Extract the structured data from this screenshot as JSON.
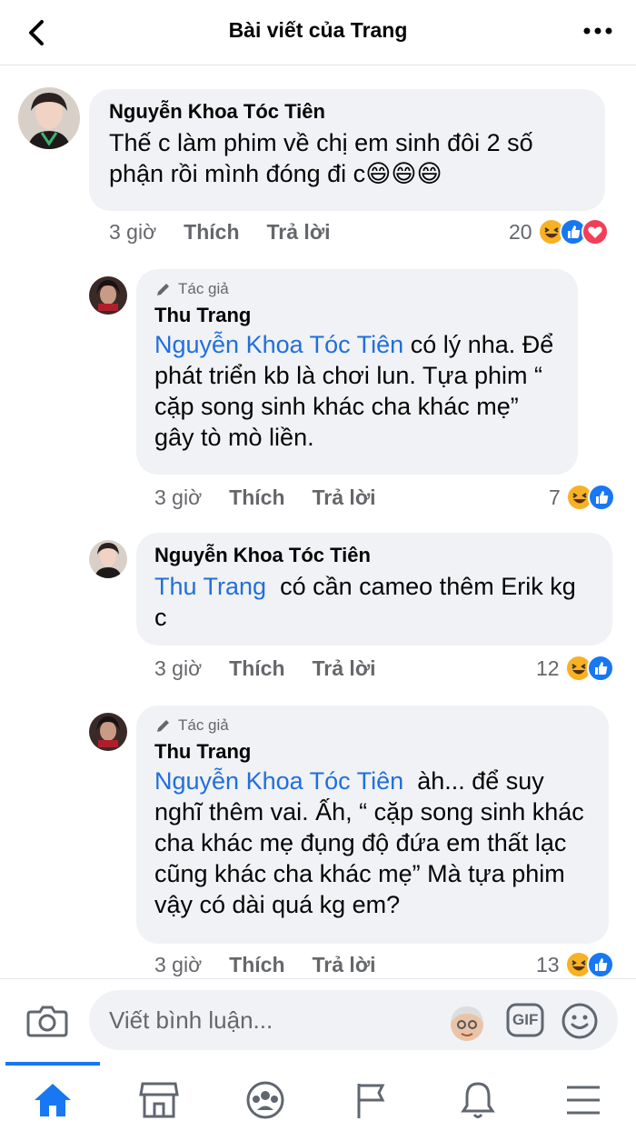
{
  "header": {
    "title": "Bài viết của Trang",
    "back_icon": "chevron-left-icon",
    "more_icon": "more-horizontal-icon"
  },
  "comments": [
    {
      "author": "Nguyễn Khoa Tóc Tiên",
      "author_badge": "",
      "text_plain": "Thế c làm phim về chị em sinh đôi 2 số phận rồi mình đóng đi c",
      "emoji": [
        "😄",
        "😄",
        "😄"
      ],
      "time": "3 giờ",
      "like": "Thích",
      "reply": "Trả lời",
      "reaction_count": "20",
      "reactions": [
        "haha",
        "like",
        "love"
      ]
    },
    {
      "author": "Thu Trang",
      "author_badge": "Tác giả",
      "mention": "Nguyễn Khoa Tóc Tiên",
      "text_plain": "có lý nha. Để phát triển kb là chơi lun. Tựa phim “ cặp song sinh khác cha khác mẹ” gây tò mò liền.",
      "time": "3 giờ",
      "like": "Thích",
      "reply": "Trả lời",
      "reaction_count": "7",
      "reactions": [
        "haha",
        "like"
      ]
    },
    {
      "author": "Nguyễn Khoa Tóc Tiên",
      "author_badge": "",
      "mention": "Thu Trang",
      "text_plain": "có cần cameo thêm Erik kg c",
      "time": "3 giờ",
      "like": "Thích",
      "reply": "Trả lời",
      "reaction_count": "12",
      "reactions": [
        "haha"
      ]
    },
    {
      "author": "Thu Trang",
      "author_badge": "Tác giả",
      "mention": "Nguyễn Khoa Tóc Tiên",
      "text_plain": "àh... để suy nghĩ thêm vai. Ấh, “ cặp song sinh khác cha khác mẹ đụng độ đứa em thất lạc cũng khác cha khác mẹ” Mà tựa phim vậy có dài quá kg em?",
      "time": "3 giờ",
      "like": "Thích",
      "reply": "Trả lời",
      "reaction_count": "13",
      "reactions": [
        "haha",
        "like"
      ]
    }
  ],
  "composer": {
    "placeholder": "Viết bình luận...",
    "gif_label": "GIF",
    "camera_icon": "camera-icon",
    "sticker_icon": "avatar-sticker-icon",
    "emoji_icon": "smiley-icon"
  },
  "tabbar": {
    "tabs": [
      "home-icon",
      "marketplace-icon",
      "groups-icon",
      "pages-flag-icon",
      "notifications-bell-icon",
      "menu-icon"
    ],
    "active": "home-icon"
  },
  "colors": {
    "accent": "#1877f2",
    "mention": "#216fdb",
    "bubble": "#f0f2f5",
    "muted": "#65676b"
  }
}
